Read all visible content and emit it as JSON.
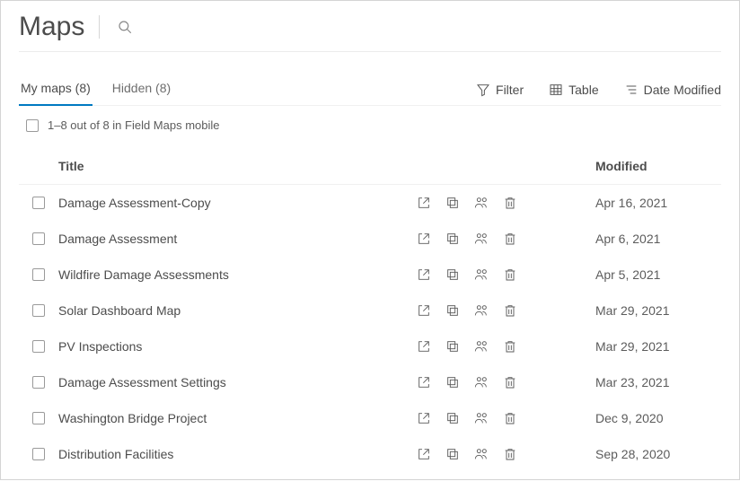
{
  "header": {
    "title": "Maps"
  },
  "tabs": {
    "my_maps_label": "My maps (8)",
    "hidden_label": "Hidden (8)"
  },
  "toolbar": {
    "filter_label": "Filter",
    "table_label": "Table",
    "sort_label": "Date Modified"
  },
  "selection": {
    "summary": "1–8 out of 8 in Field Maps mobile"
  },
  "columns": {
    "title": "Title",
    "modified": "Modified"
  },
  "rows": [
    {
      "title": "Damage Assessment-Copy",
      "modified": "Apr 16, 2021"
    },
    {
      "title": "Damage Assessment",
      "modified": "Apr 6, 2021"
    },
    {
      "title": "Wildfire Damage Assessments",
      "modified": "Apr 5, 2021"
    },
    {
      "title": "Solar Dashboard Map",
      "modified": "Mar 29, 2021"
    },
    {
      "title": "PV Inspections",
      "modified": "Mar 29, 2021"
    },
    {
      "title": "Damage Assessment Settings",
      "modified": "Mar 23, 2021"
    },
    {
      "title": "Washington Bridge Project",
      "modified": "Dec 9, 2020"
    },
    {
      "title": "Distribution Facilities",
      "modified": "Sep 28, 2020"
    }
  ],
  "icons": {
    "search": "search-icon",
    "filter": "filter-icon",
    "table": "table-icon",
    "sort": "sort-icon",
    "open": "open-external-icon",
    "duplicate": "duplicate-icon",
    "share": "share-group-icon",
    "delete": "trash-icon"
  }
}
